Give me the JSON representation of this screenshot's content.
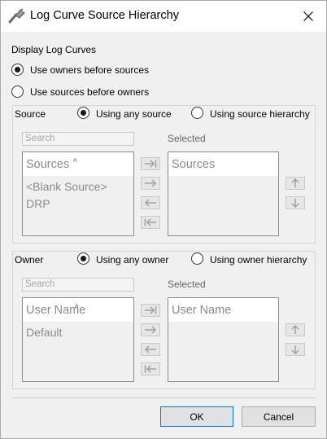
{
  "window": {
    "title": "Log Curve Source Hierarchy"
  },
  "display": {
    "heading": "Display Log Curves",
    "options": [
      {
        "label": "Use owners before sources",
        "selected": true
      },
      {
        "label": "Use sources before owners",
        "selected": false
      }
    ]
  },
  "source": {
    "label": "Source",
    "radios": [
      {
        "label": "Using any source",
        "selected": true
      },
      {
        "label": "Using source hierarchy",
        "selected": false
      }
    ],
    "search_placeholder": "Search",
    "selected_label": "Selected",
    "available": {
      "header": "Sources",
      "items": [
        "<Blank Source>",
        "DRP"
      ]
    },
    "chosen": {
      "header": "Sources",
      "items": []
    }
  },
  "owner": {
    "label": "Owner",
    "radios": [
      {
        "label": "Using any owner",
        "selected": true
      },
      {
        "label": "Using owner hierarchy",
        "selected": false
      }
    ],
    "search_placeholder": "Search",
    "selected_label": "Selected",
    "available": {
      "header": "User Name",
      "items": [
        "Default"
      ]
    },
    "chosen": {
      "header": "User Name",
      "items": []
    }
  },
  "buttons": {
    "ok": "OK",
    "cancel": "Cancel"
  },
  "colors": {
    "accent": "#0078d7",
    "disabled_text": "#8a8a8a",
    "background": "#f0f0f0"
  }
}
